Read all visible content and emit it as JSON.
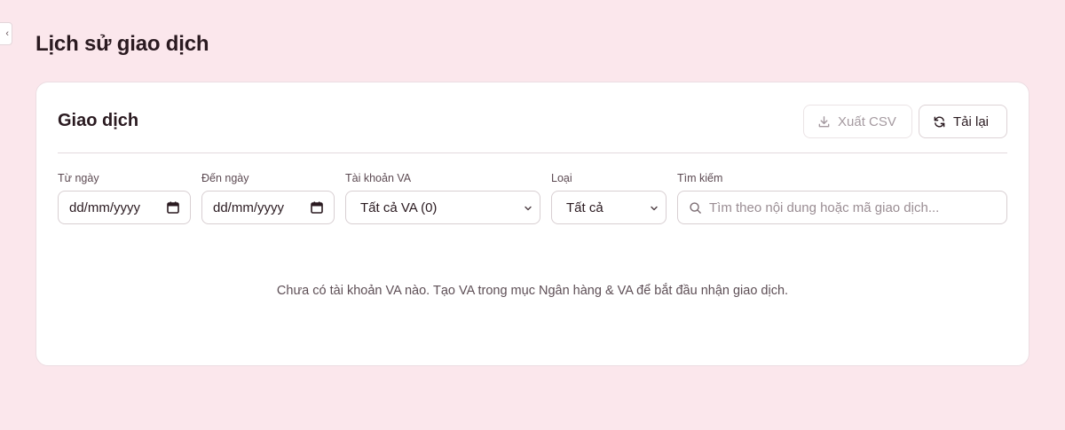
{
  "page": {
    "title": "Lịch sử giao dịch",
    "collapse_glyph": "‹"
  },
  "card": {
    "title": "Giao dịch",
    "export_label": "Xuất CSV",
    "reload_label": "Tải lại"
  },
  "filters": {
    "from_label": "Từ ngày",
    "from_value": "dd/mm/yyyy",
    "to_label": "Đến ngày",
    "to_value": "dd/mm/yyyy",
    "va_label": "Tài khoản VA",
    "va_value": "Tất cả VA (0)",
    "type_label": "Loại",
    "type_value": "Tất cả",
    "search_label": "Tìm kiếm",
    "search_placeholder": "Tìm theo nội dung hoặc mã giao dịch..."
  },
  "empty_message": "Chưa có tài khoản VA nào. Tạo VA trong mục Ngân hàng & VA để bắt đầu nhận giao dịch.",
  "icons": {
    "export": "download-icon",
    "reload": "refresh-icon",
    "date": "calendar-icon",
    "select": "chevron-down-icon",
    "search": "search-icon"
  },
  "colors": {
    "background": "#fbe7ec",
    "card": "#ffffff",
    "text": "#2a1a20"
  }
}
